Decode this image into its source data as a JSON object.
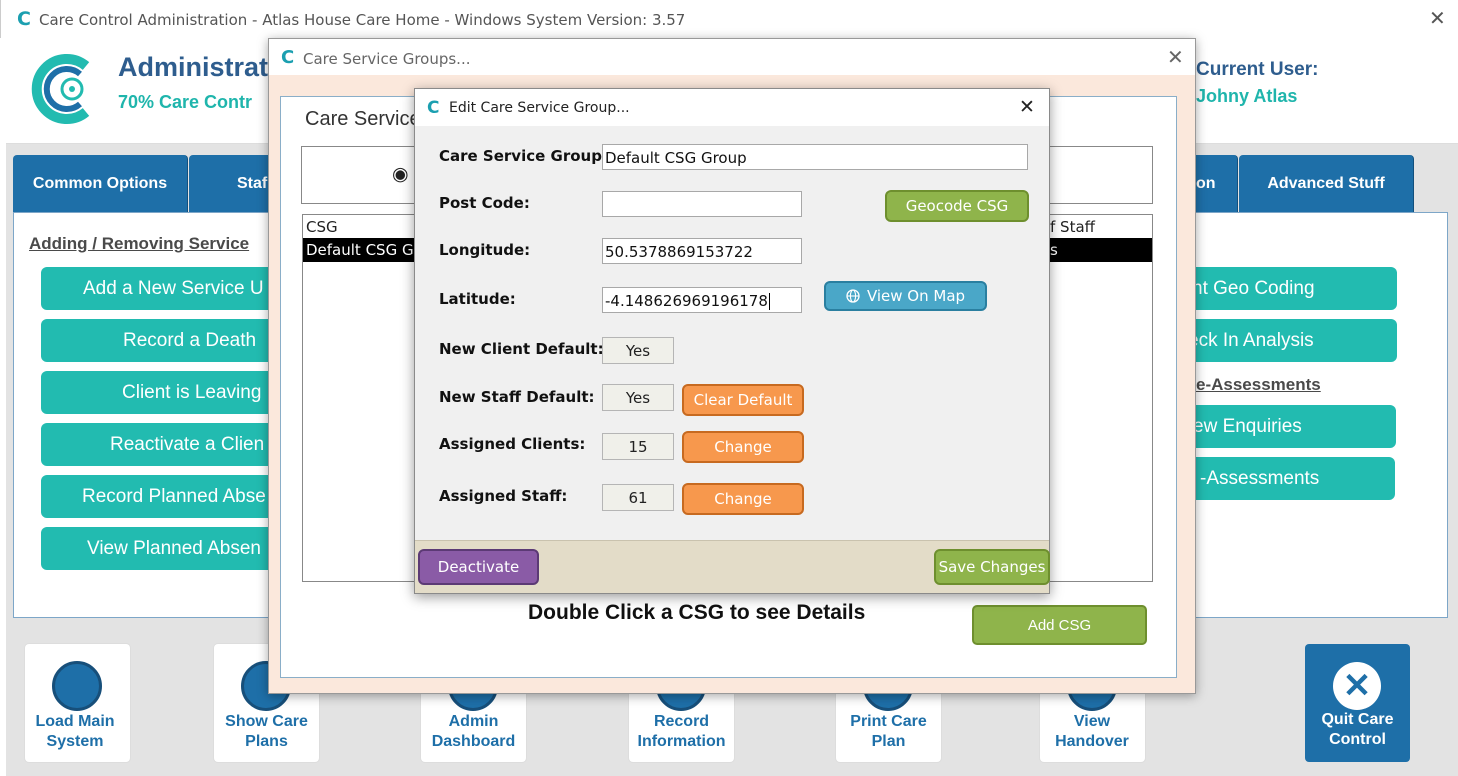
{
  "window": {
    "title": "Care Control Administration - Atlas House Care Home - Windows System Version: 3.57",
    "close": "✕"
  },
  "header": {
    "title": "Administrat",
    "subtitle": "70% Care Contr",
    "current_user_label": "Current User:",
    "current_user": "Johny Atlas"
  },
  "tabs": [
    {
      "label": "Common Options"
    },
    {
      "label": "Staf"
    },
    {
      "label": "on"
    },
    {
      "label": "Advanced Stuff"
    }
  ],
  "left_section": {
    "heading": "Adding / Removing Service",
    "buttons": [
      {
        "label": "Add a New Service U"
      },
      {
        "label": "Record a Death"
      },
      {
        "label": "Client is Leaving"
      },
      {
        "label": "Reactivate a Clien"
      },
      {
        "label": "Record Planned Abse"
      },
      {
        "label": "View Planned Absen"
      }
    ]
  },
  "right_section": {
    "buttons_top": [
      {
        "label": "nt Geo Coding"
      },
      {
        "label": "eck In Analysis"
      }
    ],
    "heading": "e-Assessments",
    "buttons_bottom": [
      {
        "label": "ew Enquiries"
      },
      {
        "label": "-Assessments"
      }
    ]
  },
  "bottom_bar": [
    {
      "label": "Load Main System"
    },
    {
      "label": "Show Care Plans"
    },
    {
      "label": "Admin Dashboard"
    },
    {
      "label": "Record Information"
    },
    {
      "label": "Print Care Plan"
    },
    {
      "label": "View Handover"
    }
  ],
  "quit": {
    "label": "Quit Care Control",
    "icon": "✕"
  },
  "csg_dialog": {
    "title": "Care Service Groups...",
    "close": "✕",
    "heading": "Care Service",
    "radio_label": "◉ A",
    "list_headers": [
      "CSG",
      "f Staff"
    ],
    "row": [
      "Default CSG Gr",
      "s"
    ],
    "hint": "Double Click a CSG to see Details",
    "add_button": "Add CSG"
  },
  "edit_dialog": {
    "title": "Edit Care Service Group...",
    "close": "✕",
    "fields": {
      "csg_label": "Care Service Group:",
      "csg_value": "Default CSG Group",
      "postcode_label": "Post Code:",
      "postcode_value": "",
      "longitude_label": "Longitude:",
      "longitude_value": "50.5378869153722",
      "latitude_label": "Latitude:",
      "latitude_value": "-4.148626969196178",
      "new_client_label": "New Client Default:",
      "new_client_value": "Yes",
      "new_staff_label": "New Staff Default:",
      "new_staff_value": "Yes",
      "assigned_clients_label": "Assigned Clients:",
      "assigned_clients_value": "15",
      "assigned_staff_label": "Assigned Staff:",
      "assigned_staff_value": "61"
    },
    "buttons": {
      "geocode": "Geocode CSG",
      "view_map": "View On Map",
      "clear_default": "Clear Default",
      "change": "Change",
      "deactivate": "Deactivate",
      "save": "Save Changes"
    }
  },
  "colors": {
    "brand_teal": "#22bbb0",
    "brand_blue": "#1e6fa8",
    "orange": "#f7984d",
    "green": "#8fb44b",
    "purple": "#8a5ba6"
  }
}
